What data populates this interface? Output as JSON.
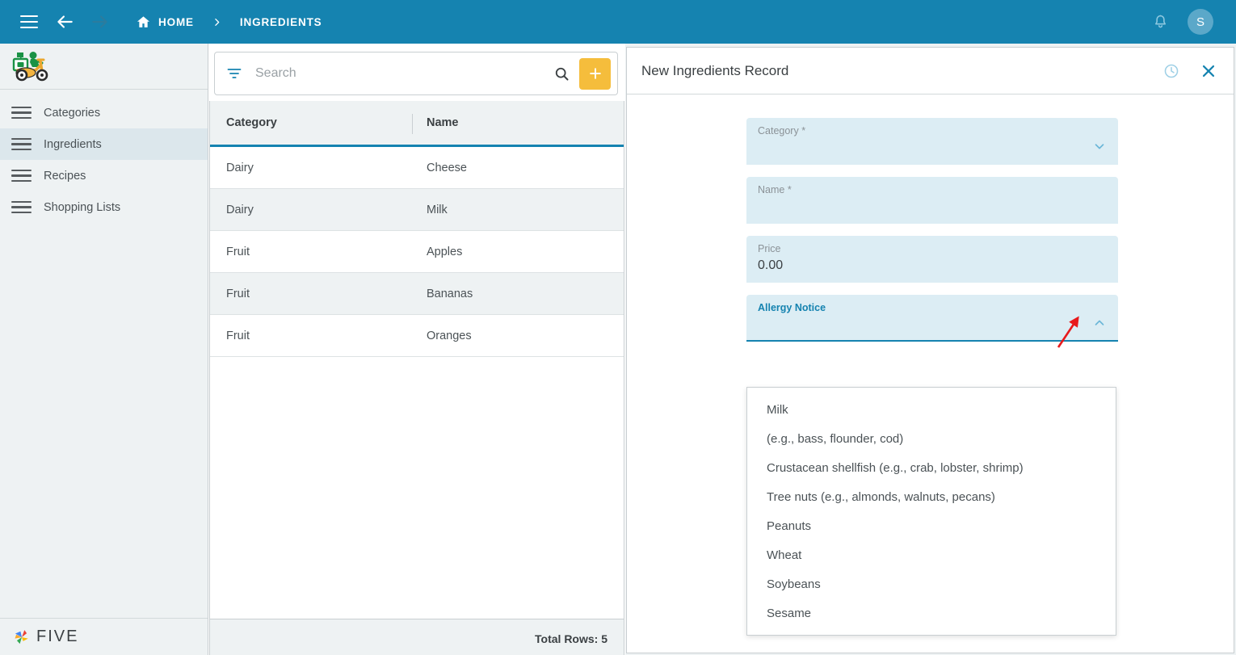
{
  "topbar": {
    "menu_icon": "hamburger-menu-icon",
    "back_icon": "arrow-back-icon",
    "forward_icon": "arrow-forward-icon",
    "home_icon": "home-icon",
    "breadcrumb": [
      {
        "label": "HOME"
      },
      {
        "label": "INGREDIENTS"
      }
    ],
    "notification_icon": "bell-icon",
    "avatar_initial": "S",
    "background_color": "#1583b0"
  },
  "sidebar": {
    "logo": "delivery-scooter-logo",
    "items": [
      {
        "label": "Categories",
        "active": false
      },
      {
        "label": "Ingredients",
        "active": true
      },
      {
        "label": "Recipes",
        "active": false
      },
      {
        "label": "Shopping Lists",
        "active": false
      }
    ],
    "brand": {
      "name": "FIVE",
      "mark": "five-pinwheel-logo"
    },
    "active_color": "#dce7ec"
  },
  "list_panel": {
    "search": {
      "placeholder": "Search",
      "value": "",
      "filter_icon": "filter-icon",
      "search_icon": "search-icon"
    },
    "add_button": {
      "label": "+",
      "icon": "plus-icon",
      "color": "#f5bd3c"
    },
    "table": {
      "columns": [
        "Category",
        "Name"
      ],
      "rows": [
        {
          "category": "Dairy",
          "name": "Cheese"
        },
        {
          "category": "Dairy",
          "name": "Milk"
        },
        {
          "category": "Fruit",
          "name": "Apples"
        },
        {
          "category": "Fruit",
          "name": "Bananas"
        },
        {
          "category": "Fruit",
          "name": "Oranges"
        }
      ],
      "footer": "Total Rows: 5",
      "header_underline_color": "#1583b0"
    }
  },
  "record_panel": {
    "title": "New Ingredients Record",
    "history_icon": "history-clock-icon",
    "close_icon": "close-icon",
    "fields": [
      {
        "label": "Category *",
        "value": "",
        "type": "select",
        "focused": false
      },
      {
        "label": "Name *",
        "value": "",
        "type": "text",
        "focused": false
      },
      {
        "label": "Price",
        "value": "0.00",
        "type": "text",
        "focused": false
      },
      {
        "label": "Allergy Notice",
        "value": "",
        "type": "select",
        "focused": true
      }
    ],
    "dropdown": {
      "open": true,
      "options": [
        "Milk",
        "(e.g., bass, flounder, cod)",
        "Crustacean shellfish (e.g., crab, lobster, shrimp)",
        "Tree nuts (e.g., almonds, walnuts, pecans)",
        "Peanuts",
        "Wheat",
        "Soybeans",
        "Sesame"
      ]
    },
    "field_background": "#dcedf4",
    "focus_color": "#1583b0"
  },
  "annotation": {
    "type": "red-arrow",
    "color": "#e8191b",
    "points_to": "allergy-notice-dropdown-chevron"
  }
}
